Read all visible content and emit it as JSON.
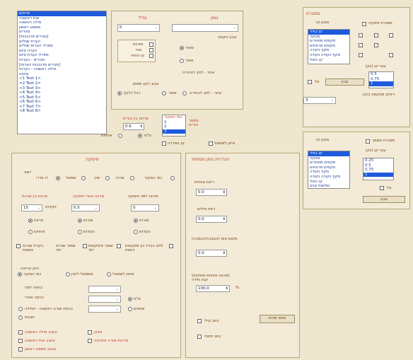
{
  "fields_list": {
    "items": [
      "פרטים",
      "אות ראשונה",
      "מילה ראשונה",
      "משפט ראשון",
      "מגירים",
      "[מגירים מרובבות]",
      "הערת שוליים",
      "מפריד הערות שוליים",
      "הערה סיום",
      "מפריד הערת סיום",
      "מגירים - הערות",
      "[מגירים מרובבות הערות]",
      "מילה ראשונה - הערות",
      "ציטוט",
      "<1 Text 1>",
      "<2 Text 2>",
      "<3 Text 3>",
      "<4 Text 4>",
      "<5 Text 5>",
      "<6 Text 6>",
      "<7 Text 7>",
      "<8 Text 8>"
    ]
  },
  "font_panel": {
    "font_label": "גופן",
    "size_label": "גודל",
    "size_value": "0",
    "style_label": "צבע טקסט",
    "style_options": [
      "מודגש",
      "נטוי",
      "קו תחתי"
    ],
    "color_label": "צבע טקסט",
    "color_options": [
      "שחור",
      "אפור",
      "אחר - לחץ לבחירה"
    ],
    "bg_label": "צבע רקע מסמן",
    "bg_options": [
      "אחר - לחץ לבחירה",
      "אפור",
      "רגיל (לבן)"
    ]
  },
  "mid_panel": {
    "spacing_label": "מרווח בין טורים",
    "spacing_value": "0.6",
    "unit_label": "ס\"מ",
    "pct_label": "אחוזים",
    "columns_label": "מספר טורים",
    "column_list": [
      "כפי המקור",
      "1",
      "2",
      "3"
    ],
    "balance_label": "איזון לשמאל",
    "border_label": "קו הפרדה"
  },
  "right_top": {
    "title": "מסגרת",
    "main_label": "מגנון קו",
    "frame_check": "מסגרת פיסקה",
    "list": [
      "קו בודד",
      "מנוקד",
      "מקפים מפוזרים",
      "מקפים מרווחים",
      "מקף נקודה",
      "מקף נקודה נקודה",
      "קו כפול"
    ],
    "thickness_label": "(עובי קו (נק",
    "thick_list": [
      "0.5",
      "0.75",
      "1"
    ],
    "shadow_label": "צל",
    "color_btn": "צבע",
    "distance_label": "ריחוק מטקסט (נק)",
    "distance_value": "3"
  },
  "right_bottom": {
    "title": "מסגרת מסמך",
    "main_label": "מגנון קו",
    "list": [
      "קו בודד",
      "מנוקד",
      "מקפים מפוזרים",
      "מקפים מרווחים",
      "מקף נקודה",
      "מקף נקודה נקודה",
      "קו כפול",
      "שלשות קוים",
      "דק עבה מרווח קטן"
    ],
    "thickness_label": "(עובי קו (נק",
    "thick_list": [
      "0.25",
      "0.5",
      "0.75",
      "1"
    ],
    "shadow_label": "צל",
    "color_btn": "צבע"
  },
  "paragraph": {
    "title": "פיסקה",
    "align_label": "יישור",
    "align_options": [
      "כפי המקור",
      "מרכז",
      "ימין",
      "שמאל",
      "דו צדדי"
    ],
    "indent_first_label": "מרווח לפני פיסקה",
    "indent_after_label": "מרווח אחרי פיסקה",
    "line_spacing_label": "מרווח בין שורות",
    "before_value": "0",
    "after_value": "0.5",
    "line_value": "15",
    "points_label": "נקודות",
    "line_unit_options": [
      "שורות",
      "נקודות"
    ],
    "after_unit_options": [
      "שורות",
      "נקודות"
    ],
    "cm_label": "מרווח",
    "pct_label": "אחוזים",
    "checks": [
      "ללא הבדל בין פסקאות דומות",
      "שמור פיסקאות יחד",
      "שמור שורות יחד",
      "בקרת שורות יתומות"
    ],
    "reading_label": "כיוון קריאה",
    "reading_options": [
      "מימין לשמאל",
      "משמאל לימין",
      "כפי המקור"
    ],
    "indent_before_label": "כניסה לפני",
    "indent_after2_label": "כניסה אחרי",
    "first_line_label": "כניסת שורה ראשונה - תחילה",
    "hanging_label": "חגווית",
    "unit_cm": "ס\"מ",
    "unit_pct": "אחוזים",
    "emphasis_options": [
      "עיצוב מילה ראשונה",
      "מכוון",
      "עיצוב אות ראשונה",
      "מרכזת שורה אחרונה",
      "עיצוב משפט ראשון"
    ]
  },
  "spacing_panel": {
    "title": "הגדרות גופן נוספות",
    "char_spacing_label": "ריווח אותיות",
    "char_spacing_value": "0.0",
    "word_spacing_label": "ריווח מילים",
    "word_spacing_value": "0.0",
    "raise_label": "(מקום אות (העבהה/הנמכה",
    "raise_value": "0.0",
    "scale_label": "(מרווה אותיות אופקית) קנה מידה",
    "scale_value": "100.0",
    "pct": "%",
    "upper_label": "כתב עילי",
    "lower_label": "כתב תחתי",
    "reset_btn": "אפס שדות"
  }
}
